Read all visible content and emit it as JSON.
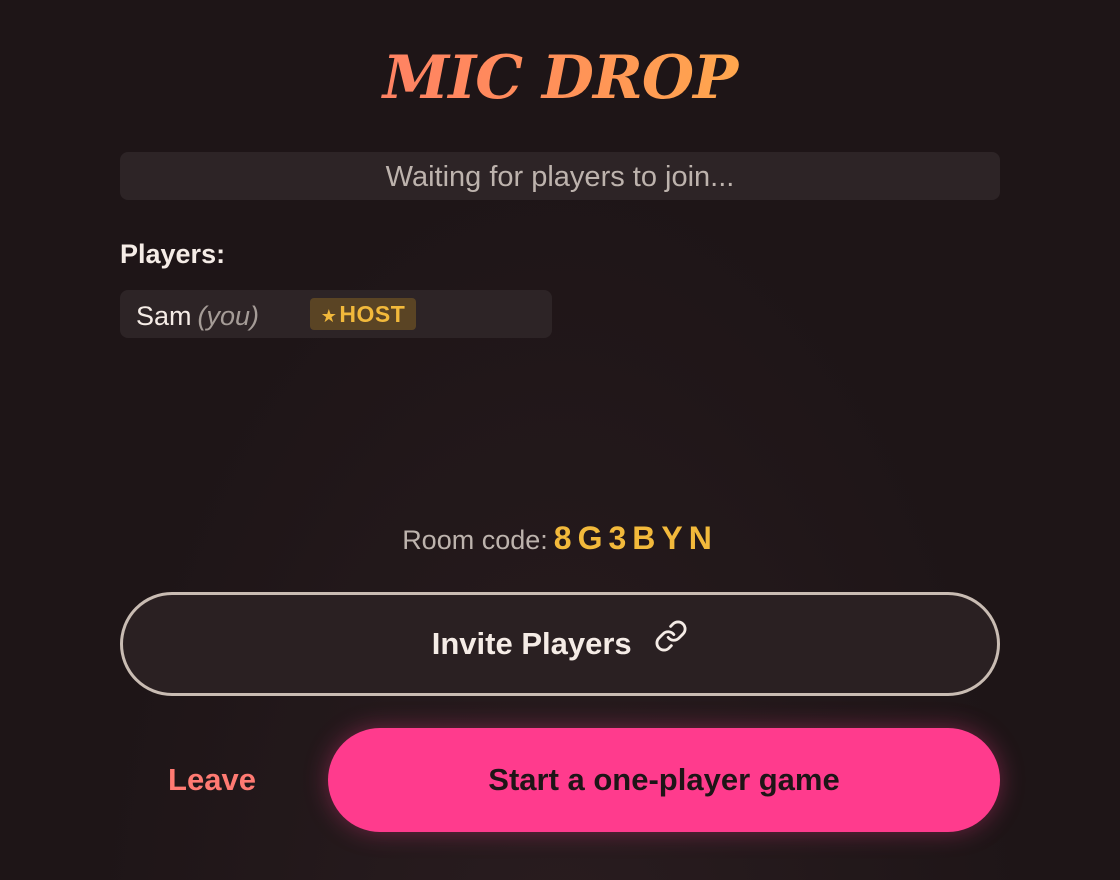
{
  "app": {
    "title": "MIC DROP"
  },
  "status": {
    "text": "Waiting for players to join..."
  },
  "players": {
    "heading": "Players:",
    "list": [
      {
        "name": "Sam",
        "you_label": "(you)",
        "badge_star": "★",
        "badge_label": "HOST"
      }
    ]
  },
  "room": {
    "label": "Room code:",
    "code": "8G3BYN"
  },
  "actions": {
    "invite_label": "Invite Players",
    "invite_icon": "link-icon",
    "leave_label": "Leave",
    "start_label": "Start a one-player game"
  },
  "colors": {
    "background": "#1e1517",
    "accent_pink": "#ff3b8d",
    "accent_gold": "#f2b93b",
    "leave_red": "#ff7a72"
  }
}
